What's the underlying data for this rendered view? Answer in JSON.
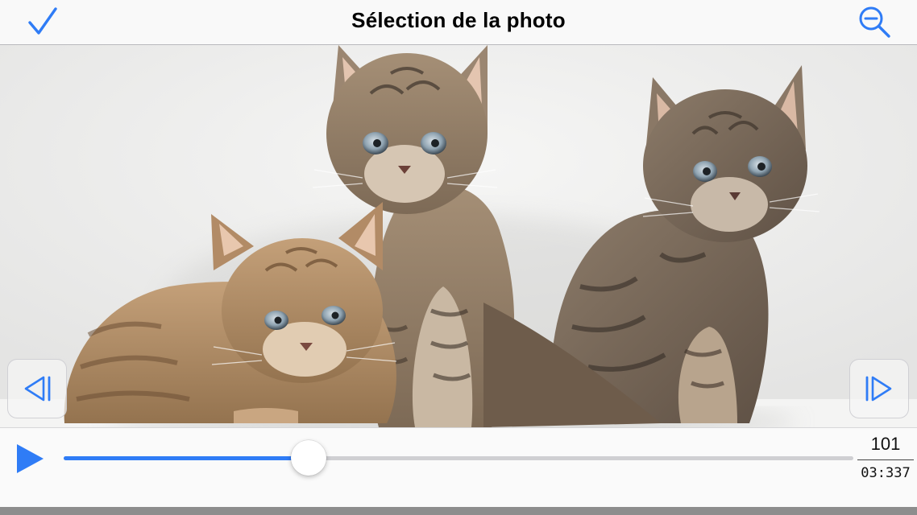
{
  "nav": {
    "title": "Sélection de la photo",
    "confirm_icon": "checkmark-icon",
    "zoom_icon": "zoom-out-icon"
  },
  "photo": {
    "subject": "three tabby kittens"
  },
  "stepper": {
    "prev_icon": "step-backward-icon",
    "next_icon": "step-forward-icon"
  },
  "playback": {
    "play_icon": "play-icon",
    "progress": 0.31,
    "frame": "101",
    "time": "03:337"
  },
  "colors": {
    "accent": "#2f7cf6",
    "track": "#cfcfd2"
  }
}
